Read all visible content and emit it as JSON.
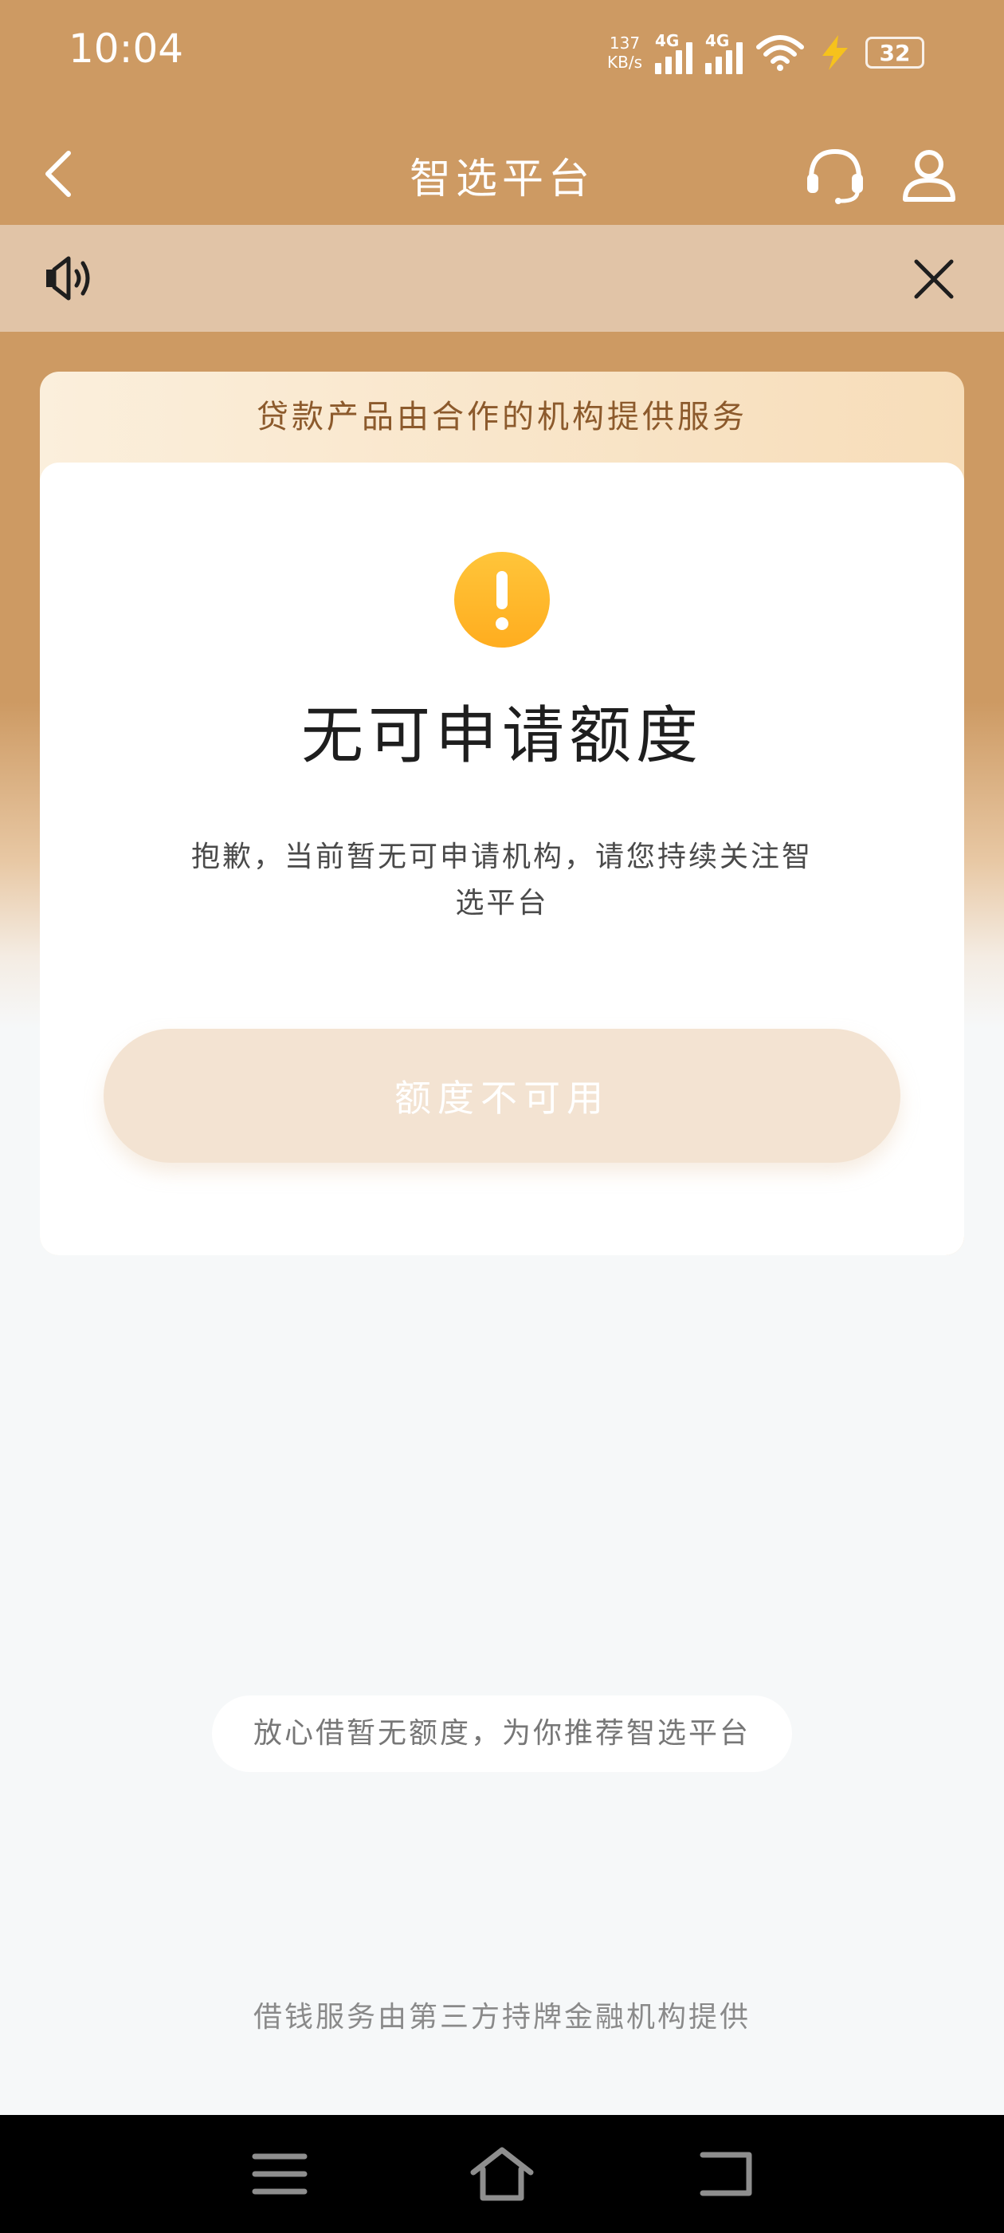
{
  "status_bar": {
    "time": "10:04",
    "speed_value": "137",
    "speed_unit": "KB/s",
    "signal1_label": "4G",
    "signal2_label": "4G",
    "battery": "32",
    "icons": [
      "signal-icon",
      "signal-icon",
      "wifi-icon",
      "charging-icon",
      "battery-icon"
    ]
  },
  "nav": {
    "title": "智选平台",
    "back_icon": "chevron-left-icon",
    "support_icon": "headset-icon",
    "user_icon": "user-icon"
  },
  "notice": {
    "speaker_icon": "speaker-icon",
    "close_icon": "close-icon"
  },
  "card": {
    "banner": "贷款产品由合作的机构提供服务",
    "title": "无可申请额度",
    "description": "抱歉，当前暂无可申请机构，请您持续关注智选平台",
    "button_label": "额度不可用",
    "icon": "warning-icon"
  },
  "recommend": {
    "text": "放心借暂无额度，为你推荐智选平台"
  },
  "footer": {
    "note": "借钱服务由第三方持牌金融机构提供"
  },
  "colors": {
    "header_bg": "#cd9a63",
    "notice_bg": "#e1c4a7",
    "accent_orange": "#ffb52a",
    "button_bg": "#f3e3d2",
    "page_bg": "#f6f8f9"
  }
}
